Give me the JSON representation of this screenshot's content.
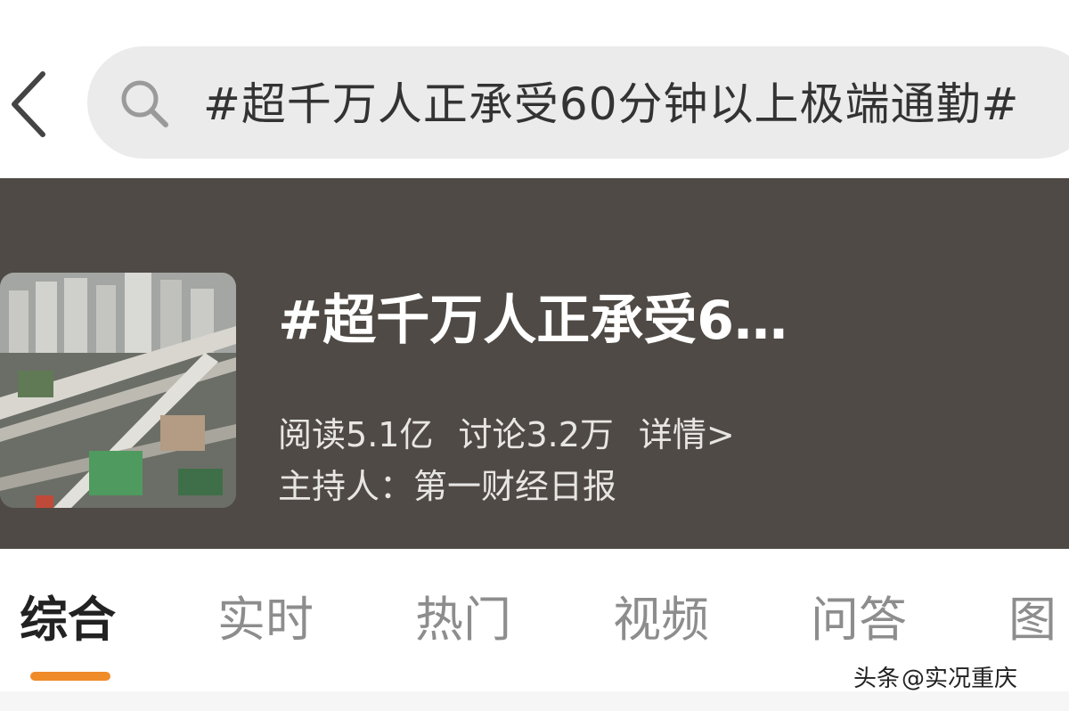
{
  "search": {
    "query": "#超千万人正承受60分钟以上极端通勤#"
  },
  "topic": {
    "title": "#超千万人正承受60分钟以上极端通勤#",
    "read_label": "阅读",
    "read_count": "5.1亿",
    "discuss_label": "讨论",
    "discuss_count": "3.2万",
    "detail_link": "详情>",
    "host_label": "主持人：",
    "host_name": "第一财经日报",
    "header_bg_color": "#4f4a45"
  },
  "tabs": [
    {
      "label": "综合",
      "active": true
    },
    {
      "label": "实时",
      "active": false
    },
    {
      "label": "热门",
      "active": false
    },
    {
      "label": "视频",
      "active": false
    },
    {
      "label": "问答",
      "active": false
    },
    {
      "label": "图",
      "active": false
    }
  ],
  "accent_color": "#f08b2a",
  "watermark": {
    "platform": "头条",
    "account": "@实况重庆"
  },
  "icons": [
    "back-arrow-icon",
    "search-icon"
  ]
}
